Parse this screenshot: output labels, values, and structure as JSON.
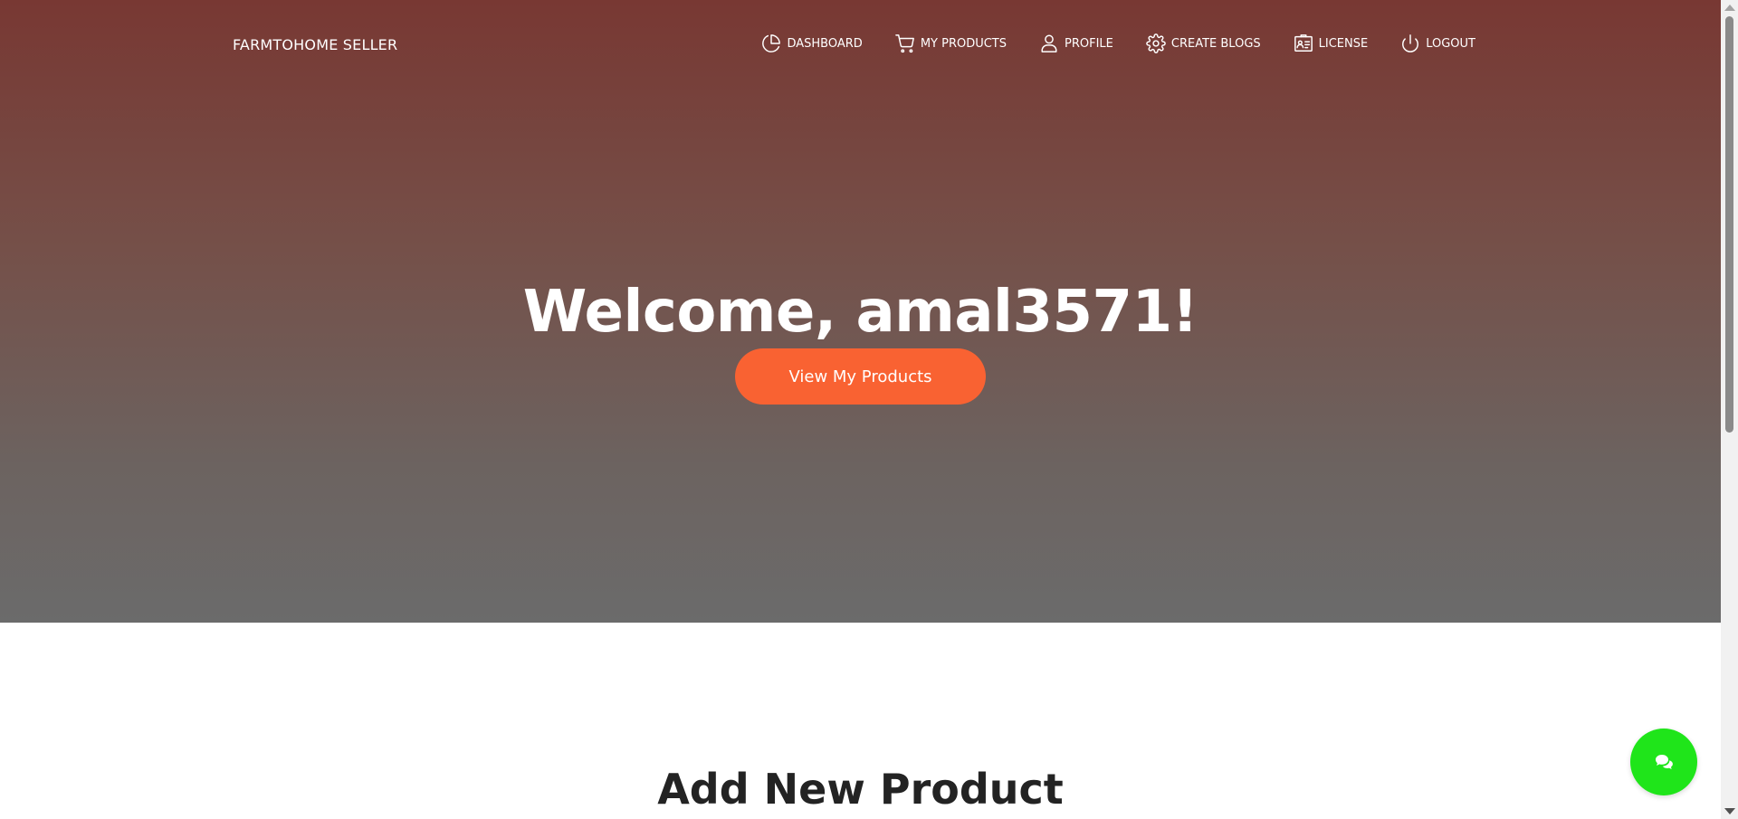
{
  "navbar": {
    "brand": "FARMTOHOME SELLER",
    "links": [
      {
        "label": "DASHBOARD",
        "icon": "pie-chart-icon"
      },
      {
        "label": "MY PRODUCTS",
        "icon": "cart-icon"
      },
      {
        "label": "PROFILE",
        "icon": "user-icon"
      },
      {
        "label": "CREATE BLOGS",
        "icon": "gear-icon"
      },
      {
        "label": "LICENSE",
        "icon": "id-card-icon"
      },
      {
        "label": "LOGOUT",
        "icon": "power-icon"
      }
    ]
  },
  "hero": {
    "title": "Welcome, amal3571!",
    "button_label": "View My Products"
  },
  "add_product": {
    "title": "Add New Product"
  },
  "chat": {
    "icon": "chat-bubbles-icon"
  },
  "colors": {
    "hero_top": "#783833",
    "hero_bottom": "#6b6b6b",
    "accent_button": "#f96232",
    "chat_button": "#1fe51a"
  }
}
